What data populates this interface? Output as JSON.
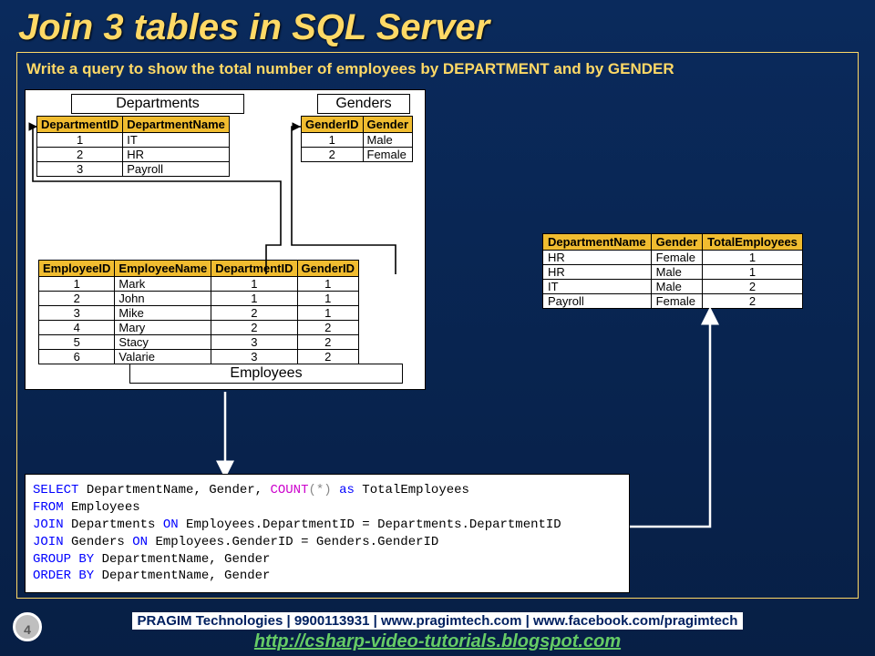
{
  "title": "Join 3 tables in SQL Server",
  "question": "Write a query to show the total number of employees by DEPARTMENT and by GENDER",
  "labels": {
    "departments": "Departments",
    "genders": "Genders",
    "employees": "Employees"
  },
  "departments": {
    "cols": [
      "DepartmentID",
      "DepartmentName"
    ],
    "rows": [
      [
        "1",
        "IT"
      ],
      [
        "2",
        "HR"
      ],
      [
        "3",
        "Payroll"
      ]
    ]
  },
  "genders": {
    "cols": [
      "GenderID",
      "Gender"
    ],
    "rows": [
      [
        "1",
        "Male"
      ],
      [
        "2",
        "Female"
      ]
    ]
  },
  "employees": {
    "cols": [
      "EmployeeID",
      "EmployeeName",
      "DepartmentID",
      "GenderID"
    ],
    "rows": [
      [
        "1",
        "Mark",
        "1",
        "1"
      ],
      [
        "2",
        "John",
        "1",
        "1"
      ],
      [
        "3",
        "Mike",
        "2",
        "1"
      ],
      [
        "4",
        "Mary",
        "2",
        "2"
      ],
      [
        "5",
        "Stacy",
        "3",
        "2"
      ],
      [
        "6",
        "Valarie",
        "3",
        "2"
      ]
    ]
  },
  "result": {
    "cols": [
      "DepartmentName",
      "Gender",
      "TotalEmployees"
    ],
    "rows": [
      [
        "HR",
        "Female",
        "1"
      ],
      [
        "HR",
        "Male",
        "1"
      ],
      [
        "IT",
        "Male",
        "2"
      ],
      [
        "Payroll",
        "Female",
        "2"
      ]
    ]
  },
  "sql": {
    "select": "SELECT",
    "col_list": " DepartmentName, Gender, ",
    "count": "COUNT",
    "count_args": "(*) ",
    "as": "as",
    "alias": " TotalEmployees",
    "from": "FROM",
    "from_tbl": " Employees",
    "join1a": "JOIN",
    "join1b": " Departments ",
    "on1a": "ON",
    "on1b": " Employees.DepartmentID = Departments.DepartmentID",
    "join2a": "JOIN",
    "join2b": " Genders ",
    "on2a": "ON",
    "on2b": " Employees.GenderID = Genders.GenderID",
    "group": "GROUP BY",
    "group_cols": " DepartmentName, Gender",
    "order": "ORDER BY",
    "order_cols": " DepartmentName, Gender"
  },
  "footer": {
    "line1": "PRAGIM Technologies | 9900113931 | www.pragimtech.com | www.facebook.com/pragimtech",
    "link": "http://csharp-video-tutorials.blogspot.com"
  },
  "page": "4"
}
